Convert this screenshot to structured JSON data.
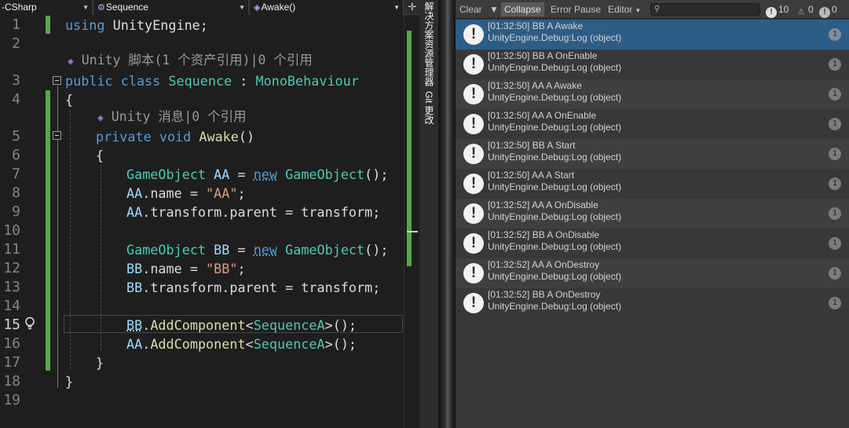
{
  "nav": {
    "project": "-CSharp",
    "class": "Sequence",
    "member": "Awake()"
  },
  "editor": {
    "line_numbers": [
      "1",
      "2",
      "3",
      "4",
      "5",
      "6",
      "7",
      "8",
      "9",
      "10",
      "11",
      "12",
      "13",
      "14",
      "15",
      "16",
      "17",
      "18",
      "19"
    ],
    "current_line": "15",
    "hint_class": "Unity 脚本(1 个资产引用)|0 个引用",
    "hint_method": "Unity 消息|0 个引用",
    "code": {
      "l1_kw": "using",
      "l1_rest": " UnityEngine;",
      "l3_kw1": "public",
      "l3_kw2": "class",
      "l3_name": "Sequence",
      "l3_colon": " : ",
      "l3_base": "MonoBehaviour",
      "l4": "{",
      "l5_kw1": "private",
      "l5_kw2": "void",
      "l5_fn": "Awake",
      "l5_paren": "()",
      "l6": "{",
      "l7_type": "GameObject",
      "l7_var": "AA",
      "l7_eq": " = ",
      "l7_new": "new",
      "l7_type2": "GameObject",
      "l7_end": "();",
      "l8_var": "AA",
      "l8_mid": ".name = ",
      "l8_str": "\"AA\"",
      "l8_end": ";",
      "l9_var": "AA",
      "l9_rest": ".transform.parent = transform;",
      "l11_type": "GameObject",
      "l11_var": "BB",
      "l11_eq": " = ",
      "l11_new": "new",
      "l11_type2": "GameObject",
      "l11_end": "();",
      "l12_var": "BB",
      "l12_mid": ".name = ",
      "l12_str": "\"BB\"",
      "l12_end": ";",
      "l13_var": "BB",
      "l13_rest": ".transform.parent = transform;",
      "l15_var": "BB",
      "l15_dot": ".",
      "l15_fn": "AddComponent",
      "l15_lt": "<",
      "l15_type": "SequenceA",
      "l15_end": ">();",
      "l16_var": "AA",
      "l16_dot": ".",
      "l16_fn": "AddComponent",
      "l16_lt": "<",
      "l16_type": "SequenceA",
      "l16_end": ">();",
      "l17": "}",
      "l18": "}"
    }
  },
  "side_tabs": {
    "solution_explorer": "解决方案资源管理器",
    "git_changes": "Git 更改"
  },
  "console": {
    "toolbar": {
      "clear": "Clear",
      "collapse": "Collapse",
      "error_pause": "Error Pause",
      "editor": "Editor",
      "search_placeholder": ""
    },
    "counts": {
      "info": "10",
      "warnings": "0",
      "errors": "0"
    },
    "entries": [
      {
        "time_msg": "[01:32:50] BB A Awake",
        "source": "UnityEngine.Debug:Log (object)",
        "count": "1"
      },
      {
        "time_msg": "[01:32:50] BB A OnEnable",
        "source": "UnityEngine.Debug:Log (object)",
        "count": "1"
      },
      {
        "time_msg": "[01:32:50] AA A Awake",
        "source": "UnityEngine.Debug:Log (object)",
        "count": "1"
      },
      {
        "time_msg": "[01:32:50] AA A OnEnable",
        "source": "UnityEngine.Debug:Log (object)",
        "count": "1"
      },
      {
        "time_msg": "[01:32:50] BB A Start",
        "source": "UnityEngine.Debug:Log (object)",
        "count": "1"
      },
      {
        "time_msg": "[01:32:50] AA A Start",
        "source": "UnityEngine.Debug:Log (object)",
        "count": "1"
      },
      {
        "time_msg": "[01:32:52] AA A OnDisable",
        "source": "UnityEngine.Debug:Log (object)",
        "count": "1"
      },
      {
        "time_msg": "[01:32:52] BB A OnDisable",
        "source": "UnityEngine.Debug:Log (object)",
        "count": "1"
      },
      {
        "time_msg": "[01:32:52] AA A OnDestroy",
        "source": "UnityEngine.Debug:Log (object)",
        "count": "1"
      },
      {
        "time_msg": "[01:32:52] BB A OnDestroy",
        "source": "UnityEngine.Debug:Log (object)",
        "count": "1"
      }
    ]
  },
  "colors": {
    "keyword": "#569cd6",
    "type": "#4ec9b0",
    "method": "#dcdcaa",
    "string": "#d69d85",
    "identifier": "#9cdcfe",
    "change_bar": "#57a64a",
    "selected_row": "#2c5d87"
  }
}
